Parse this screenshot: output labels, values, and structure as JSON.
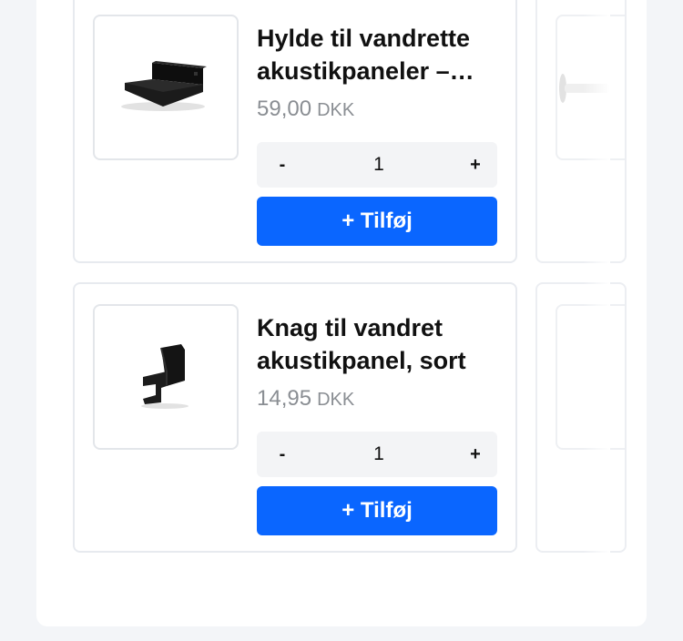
{
  "products": [
    {
      "title": "Hylde til vandrette akustikpaneler – sort",
      "price": "59,00",
      "currency": "DKK",
      "quantity": "1",
      "minus": "-",
      "plus": "+",
      "add_label": "+ Tilføj",
      "image_icon": "shelf-bracket-icon"
    },
    {
      "title": "Knag til vandret akustikpanel, sort",
      "price": "14,95",
      "currency": "DKK",
      "quantity": "1",
      "minus": "-",
      "plus": "+",
      "add_label": "+ Tilføj",
      "image_icon": "hook-bracket-icon"
    }
  ],
  "colors": {
    "accent": "#0a66ff",
    "price_text": "#8a8e93",
    "stepper_bg": "#f3f4f6"
  }
}
